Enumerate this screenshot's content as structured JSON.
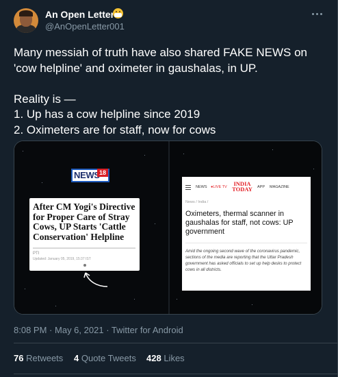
{
  "author": {
    "display_name": "An Open Letter",
    "handle": "@AnOpenLetter001",
    "emoji": "masked-face-emoji"
  },
  "tweet": {
    "text": "Many messiah of truth have also shared FAKE NEWS on 'cow helpline' and oximeter in gaushalas, in UP.\n\nReality is —\n1. Up has a cow helpline since 2019\n2. Oximeters are for staff, now for cows"
  },
  "media": {
    "left": {
      "logo_text": "NEWS",
      "logo_badge": "18",
      "headline": "After CM Yogi's Directive for Proper Care of Stray Cows, UP Starts 'Cattle Conservation' Helpline",
      "source": "PTI",
      "updated": "Updated: January 05, 2019, 15:37 IST"
    },
    "right": {
      "nav_items": [
        "NEWS",
        "●LIVE TV",
        "APP",
        "MAGAZINE"
      ],
      "logo_line1": "INDIA",
      "logo_line2": "TODAY",
      "breadcrumb": "News / India /",
      "headline": "Oximeters, thermal scanner in gaushalas for staff, not cows: UP government",
      "summary": "Amid the ongoing second wave of the coronavirus pandemic, sections of the media are reporting that the Uttar Pradesh government has asked officials to set up help desks to protect cows in all districts."
    }
  },
  "meta": {
    "time": "8:08 PM",
    "separator": "·",
    "date": "May 6, 2021",
    "client": "Twitter for Android"
  },
  "stats": [
    {
      "count": "76",
      "label": "Retweets"
    },
    {
      "count": "4",
      "label": "Quote Tweets"
    },
    {
      "count": "428",
      "label": "Likes"
    }
  ],
  "colors": {
    "background": "#15202b",
    "secondary_text": "#8899a6",
    "border": "#38444d"
  }
}
